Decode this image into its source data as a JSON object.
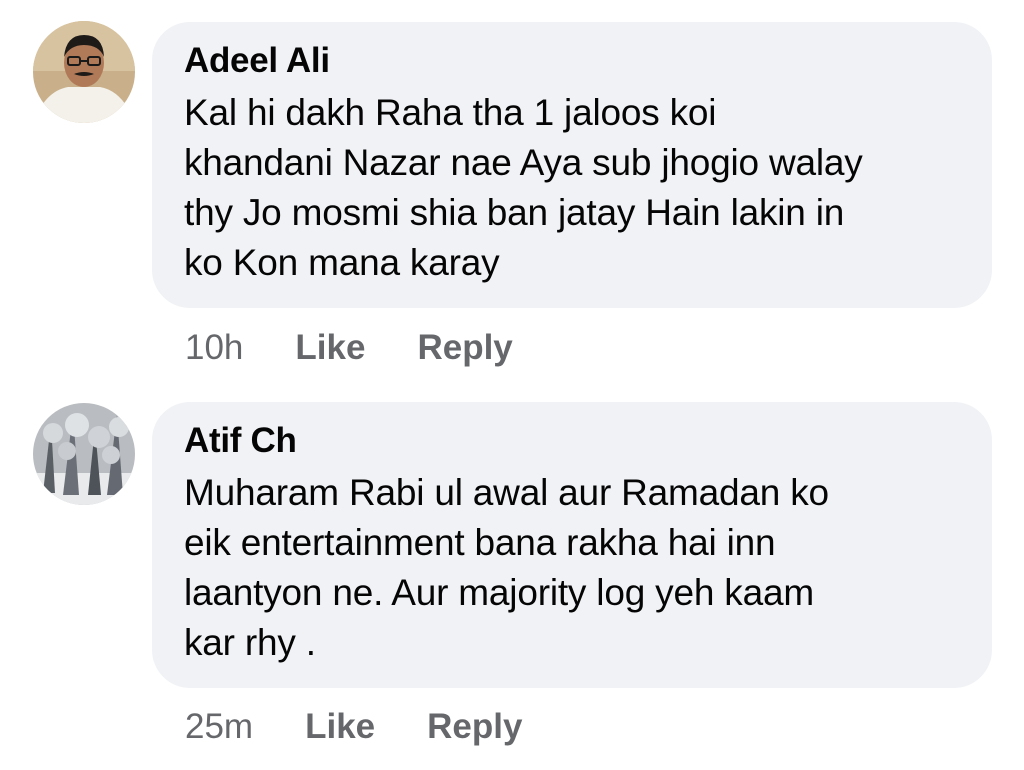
{
  "comments": [
    {
      "author": "Adeel Ali",
      "text": "Kal hi dakh Raha tha 1 jaloos koi\nkhandani Nazar nae Aya sub jhogio walay\nthy Jo mosmi shia ban jatay Hain lakin in\nko Kon mana karay",
      "time": "10h",
      "like_label": "Like",
      "reply_label": "Reply",
      "avatar": "profile-photo-man-in-white-shirt"
    },
    {
      "author": "Atif Ch",
      "text": "Muharam Rabi ul awal aur Ramadan ko\neik entertainment bana rakha hai inn\nlaantyon ne. Aur majority log yeh kaam\nkar rhy .",
      "time": "25m",
      "like_label": "Like",
      "reply_label": "Reply",
      "avatar": "profile-photo-snowy-trees"
    }
  ],
  "colors": {
    "bubble_bg": "#f0f2f5",
    "meta_text": "#65676b",
    "primary_text": "#050505"
  }
}
